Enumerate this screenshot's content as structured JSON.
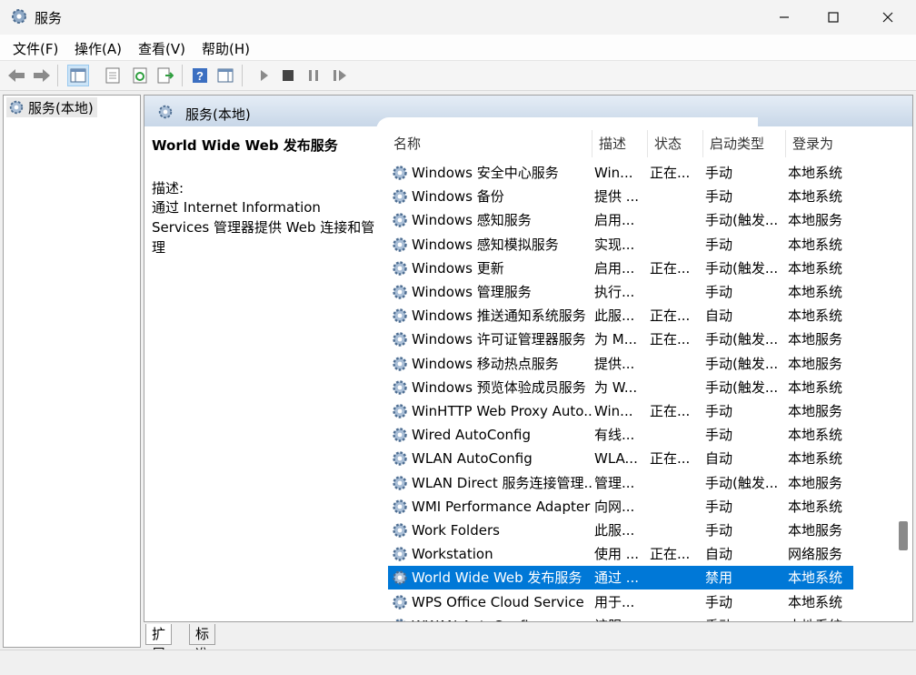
{
  "window": {
    "title": "服务",
    "minimize_icon": "minimize-icon",
    "maximize_icon": "maximize-icon",
    "close_icon": "close-icon"
  },
  "menu": [
    "文件(F)",
    "操作(A)",
    "查看(V)",
    "帮助(H)"
  ],
  "tree": {
    "root_label": "服务(本地)"
  },
  "panel": {
    "title": "服务(本地)"
  },
  "description": {
    "service_name": "World Wide Web 发布服务",
    "label": "描述:",
    "text": "通过 Internet Information Services 管理器提供 Web 连接和管理"
  },
  "columns": [
    "名称",
    "描述",
    "状态",
    "启动类型",
    "登录为"
  ],
  "services": [
    {
      "name": "Windows 安全中心服务",
      "desc": "Win...",
      "status": "正在...",
      "startup": "手动",
      "logon": "本地系统"
    },
    {
      "name": "Windows 备份",
      "desc": "提供 ...",
      "status": "",
      "startup": "手动",
      "logon": "本地系统"
    },
    {
      "name": "Windows 感知服务",
      "desc": "启用...",
      "status": "",
      "startup": "手动(触发...",
      "logon": "本地服务"
    },
    {
      "name": "Windows 感知模拟服务",
      "desc": "实现...",
      "status": "",
      "startup": "手动",
      "logon": "本地系统"
    },
    {
      "name": "Windows 更新",
      "desc": "启用...",
      "status": "正在...",
      "startup": "手动(触发...",
      "logon": "本地系统"
    },
    {
      "name": "Windows 管理服务",
      "desc": "执行...",
      "status": "",
      "startup": "手动",
      "logon": "本地系统"
    },
    {
      "name": "Windows 推送通知系统服务",
      "desc": "此服...",
      "status": "正在...",
      "startup": "自动",
      "logon": "本地系统"
    },
    {
      "name": "Windows 许可证管理器服务",
      "desc": "为 M...",
      "status": "正在...",
      "startup": "手动(触发...",
      "logon": "本地服务"
    },
    {
      "name": "Windows 移动热点服务",
      "desc": "提供...",
      "status": "",
      "startup": "手动(触发...",
      "logon": "本地服务"
    },
    {
      "name": "Windows 预览体验成员服务",
      "desc": "为 W...",
      "status": "",
      "startup": "手动(触发...",
      "logon": "本地系统"
    },
    {
      "name": "WinHTTP Web Proxy Auto...",
      "desc": "Win...",
      "status": "正在...",
      "startup": "手动",
      "logon": "本地服务"
    },
    {
      "name": "Wired AutoConfig",
      "desc": "有线...",
      "status": "",
      "startup": "手动",
      "logon": "本地系统"
    },
    {
      "name": "WLAN AutoConfig",
      "desc": "WLA...",
      "status": "正在...",
      "startup": "自动",
      "logon": "本地系统"
    },
    {
      "name": "WLAN Direct 服务连接管理...",
      "desc": "管理...",
      "status": "",
      "startup": "手动(触发...",
      "logon": "本地服务"
    },
    {
      "name": "WMI Performance Adapter",
      "desc": "向网...",
      "status": "",
      "startup": "手动",
      "logon": "本地系统"
    },
    {
      "name": "Work Folders",
      "desc": "此服...",
      "status": "",
      "startup": "手动",
      "logon": "本地服务"
    },
    {
      "name": "Workstation",
      "desc": "使用 ...",
      "status": "正在...",
      "startup": "自动",
      "logon": "网络服务"
    },
    {
      "name": "World Wide Web 发布服务",
      "desc": "通过 ...",
      "status": "",
      "startup": "禁用",
      "logon": "本地系统",
      "selected": true
    },
    {
      "name": "WPS Office Cloud Service",
      "desc": "用于...",
      "status": "",
      "startup": "手动",
      "logon": "本地系统"
    },
    {
      "name": "WWAN AutoConfig",
      "desc": "该服...",
      "status": "",
      "startup": "手动",
      "logon": "本地系统"
    }
  ],
  "tabs": [
    "扩展",
    "标准"
  ],
  "colors": {
    "selection": "#0078d7",
    "panel_header": "#c8d7e8"
  }
}
